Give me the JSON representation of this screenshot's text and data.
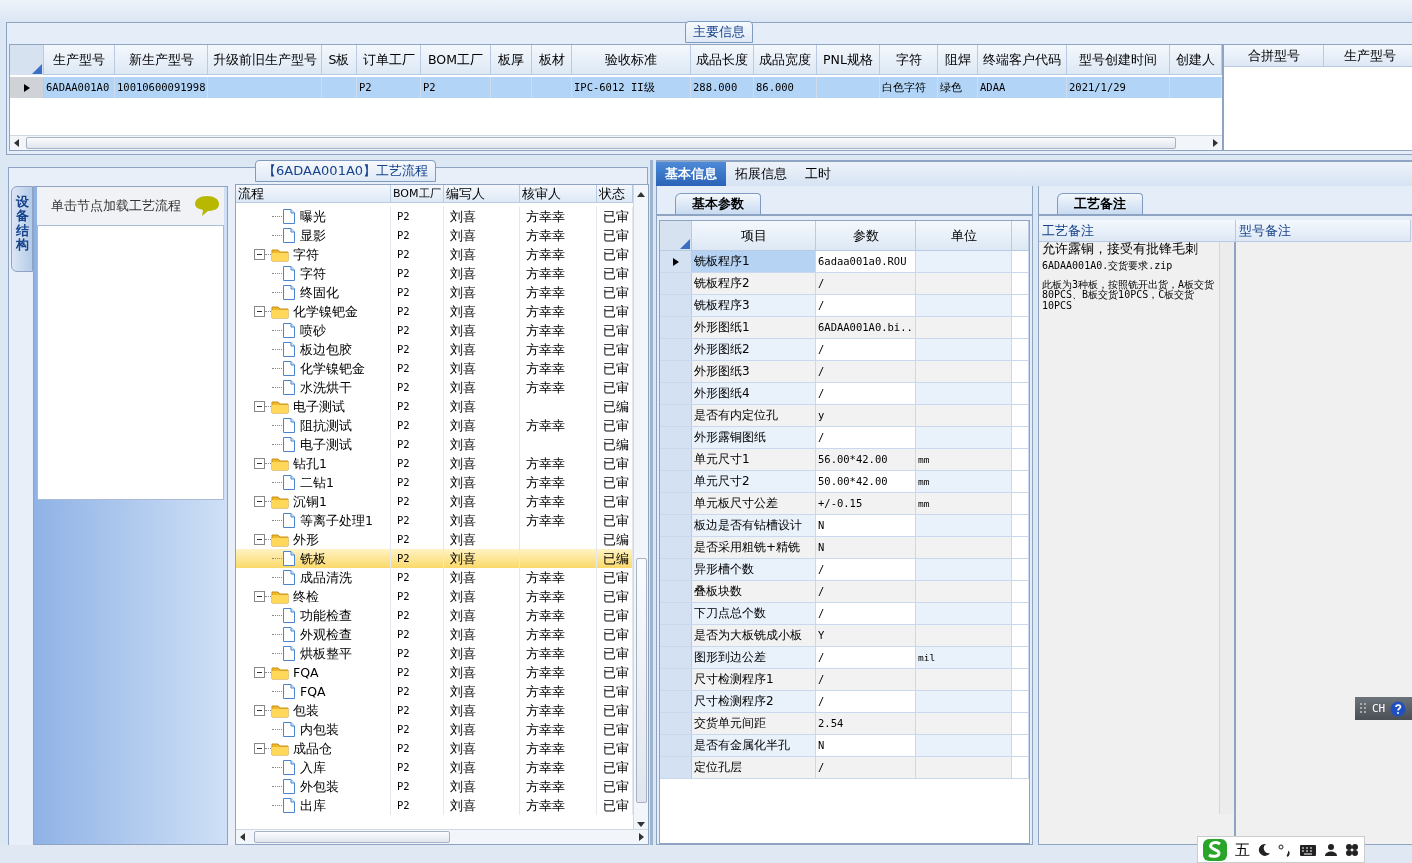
{
  "main_info": {
    "title": "主要信息",
    "columns": [
      "生产型号",
      "新生产型号",
      "升级前旧生产型号",
      "S板",
      "订单工厂",
      "BOM工厂",
      "板厚",
      "板材",
      "验收标准",
      "成品长度",
      "成品宽度",
      "PNL规格",
      "字符",
      "阻焊",
      "终端客户代码",
      "型号创建时间",
      "创建人"
    ],
    "rows": [
      {
        "selected": true,
        "cells": [
          "6ADAA001A0",
          "10010600091998",
          null,
          null,
          "P2",
          "P2",
          null,
          null,
          "IPC-6012 II级",
          "288.000",
          "86.000",
          null,
          "白色字符",
          "绿色",
          "ADAA",
          "2021/1/29",
          null
        ]
      }
    ],
    "side_columns": [
      "合拼型号",
      "生产型号"
    ]
  },
  "process": {
    "title": "【6ADAA001A0】工艺流程",
    "side_tab": "设备结构",
    "hint": "单击节点加载工艺流程",
    "columns": [
      "流程",
      "BOM工厂",
      "编写人",
      "核审人",
      "状态"
    ],
    "nodes": [
      {
        "children": [
          {
            "kind": "step",
            "label": "曝光",
            "factory": "P2",
            "writer": "刘喜",
            "reviewer": "方幸幸",
            "status": "已审",
            "selected": false
          },
          {
            "kind": "step",
            "label": "显影",
            "factory": "P2",
            "writer": "刘喜",
            "reviewer": "方幸幸",
            "status": "已审",
            "selected": false
          }
        ]
      },
      {
        "kind": "group",
        "label": "字符",
        "factory": "P2",
        "writer": "刘喜",
        "reviewer": "方幸幸",
        "status": "已审",
        "selected": false,
        "expanded": true,
        "children": [
          {
            "kind": "step",
            "label": "字符",
            "factory": "P2",
            "writer": "刘喜",
            "reviewer": "方幸幸",
            "status": "已审",
            "selected": false
          },
          {
            "kind": "step",
            "label": "终固化",
            "factory": "P2",
            "writer": "刘喜",
            "reviewer": "方幸幸",
            "status": "已审",
            "selected": false
          }
        ]
      },
      {
        "kind": "group",
        "label": "化学镍钯金",
        "factory": "P2",
        "writer": "刘喜",
        "reviewer": "方幸幸",
        "status": "已审",
        "selected": false,
        "expanded": true,
        "children": [
          {
            "kind": "step",
            "label": "喷砂",
            "factory": "P2",
            "writer": "刘喜",
            "reviewer": "方幸幸",
            "status": "已审",
            "selected": false
          },
          {
            "kind": "step",
            "label": "板边包胶",
            "factory": "P2",
            "writer": "刘喜",
            "reviewer": "方幸幸",
            "status": "已审",
            "selected": false
          },
          {
            "kind": "step",
            "label": "化学镍钯金",
            "factory": "P2",
            "writer": "刘喜",
            "reviewer": "方幸幸",
            "status": "已审",
            "selected": false
          },
          {
            "kind": "step",
            "label": "水洗烘干",
            "factory": "P2",
            "writer": "刘喜",
            "reviewer": "方幸幸",
            "status": "已审",
            "selected": false
          }
        ]
      },
      {
        "kind": "group",
        "label": "电子测试",
        "factory": "P2",
        "writer": "刘喜",
        "status": "已编",
        "selected": false,
        "expanded": true,
        "children": [
          {
            "kind": "step",
            "label": "阻抗测试",
            "factory": "P2",
            "writer": "刘喜",
            "reviewer": "方幸幸",
            "status": "已审",
            "selected": false
          },
          {
            "kind": "step",
            "label": "电子测试",
            "factory": "P2",
            "writer": "刘喜",
            "status": "已编",
            "selected": false
          }
        ]
      },
      {
        "kind": "group",
        "label": "钻孔1",
        "factory": "P2",
        "writer": "刘喜",
        "reviewer": "方幸幸",
        "status": "已审",
        "selected": false,
        "expanded": true,
        "children": [
          {
            "kind": "step",
            "label": "二钻1",
            "factory": "P2",
            "writer": "刘喜",
            "reviewer": "方幸幸",
            "status": "已审",
            "selected": false
          }
        ]
      },
      {
        "kind": "group",
        "label": "沉铜1",
        "factory": "P2",
        "writer": "刘喜",
        "reviewer": "方幸幸",
        "status": "已审",
        "selected": false,
        "expanded": true,
        "children": [
          {
            "kind": "step",
            "label": "等离子处理1",
            "factory": "P2",
            "writer": "刘喜",
            "reviewer": "方幸幸",
            "status": "已审",
            "selected": false
          }
        ]
      },
      {
        "kind": "group",
        "label": "外形",
        "factory": "P2",
        "writer": "刘喜",
        "status": "已编",
        "selected": false,
        "expanded": true,
        "children": [
          {
            "kind": "step",
            "label": "铣板",
            "factory": "P2",
            "writer": "刘喜",
            "status": "已编",
            "selected": true
          },
          {
            "kind": "step",
            "label": "成品清洗",
            "factory": "P2",
            "writer": "刘喜",
            "reviewer": "方幸幸",
            "status": "已审",
            "selected": false
          }
        ]
      },
      {
        "kind": "group",
        "label": "终检",
        "factory": "P2",
        "writer": "刘喜",
        "reviewer": "方幸幸",
        "status": "已审",
        "selected": false,
        "expanded": true,
        "children": [
          {
            "kind": "step",
            "label": "功能检查",
            "factory": "P2",
            "writer": "刘喜",
            "reviewer": "方幸幸",
            "status": "已审",
            "selected": false
          },
          {
            "kind": "step",
            "label": "外观检查",
            "factory": "P2",
            "writer": "刘喜",
            "reviewer": "方幸幸",
            "status": "已审",
            "selected": false
          },
          {
            "kind": "step",
            "label": "烘板整平",
            "factory": "P2",
            "writer": "刘喜",
            "reviewer": "方幸幸",
            "status": "已审",
            "selected": false
          }
        ]
      },
      {
        "kind": "group",
        "label": "FQA",
        "factory": "P2",
        "writer": "刘喜",
        "reviewer": "方幸幸",
        "status": "已审",
        "selected": false,
        "expanded": true,
        "children": [
          {
            "kind": "step",
            "label": "FQA",
            "factory": "P2",
            "writer": "刘喜",
            "reviewer": "方幸幸",
            "status": "已审",
            "selected": false
          }
        ]
      },
      {
        "kind": "group",
        "label": "包装",
        "factory": "P2",
        "writer": "刘喜",
        "reviewer": "方幸幸",
        "status": "已审",
        "selected": false,
        "expanded": true,
        "children": [
          {
            "kind": "step",
            "label": "内包装",
            "factory": "P2",
            "writer": "刘喜",
            "reviewer": "方幸幸",
            "status": "已审",
            "selected": false
          }
        ]
      },
      {
        "kind": "group",
        "label": "成品仓",
        "factory": "P2",
        "writer": "刘喜",
        "reviewer": "方幸幸",
        "status": "已审",
        "selected": false,
        "expanded": true,
        "children": [
          {
            "kind": "step",
            "label": "入库",
            "factory": "P2",
            "writer": "刘喜",
            "reviewer": "方幸幸",
            "status": "已审",
            "selected": false
          },
          {
            "kind": "step",
            "label": "外包装",
            "factory": "P2",
            "writer": "刘喜",
            "reviewer": "方幸幸",
            "status": "已审",
            "selected": false
          },
          {
            "kind": "step",
            "label": "出库",
            "factory": "P2",
            "writer": "刘喜",
            "reviewer": "方幸幸",
            "status": "已审",
            "selected": false
          }
        ]
      }
    ]
  },
  "tabs": [
    {
      "label": "基本信息",
      "selected": true
    },
    {
      "label": "拓展信息",
      "selected": false
    },
    {
      "label": "工时",
      "selected": false
    }
  ],
  "params": {
    "tab": "基本参数",
    "columns": [
      "项目",
      "参数",
      "单位"
    ],
    "rows": [
      {
        "item": "铣板程序1",
        "value": "6adaa001a0.ROU",
        "selected": true
      },
      {
        "item": "铣板程序2",
        "value": "/",
        "selected": false
      },
      {
        "item": "铣板程序3",
        "value": "/",
        "selected": false
      },
      {
        "item": "外形图纸1",
        "value": "6ADAA001A0.bi...",
        "selected": false
      },
      {
        "item": "外形图纸2",
        "value": "/",
        "selected": false
      },
      {
        "item": "外形图纸3",
        "value": "/",
        "selected": false
      },
      {
        "item": "外形图纸4",
        "value": "/",
        "selected": false
      },
      {
        "item": "是否有内定位孔",
        "value": "y",
        "selected": false
      },
      {
        "item": "外形露铜图纸",
        "value": "/",
        "selected": false
      },
      {
        "item": "单元尺寸1",
        "value": "56.00*42.00",
        "unit": "mm",
        "selected": false
      },
      {
        "item": "单元尺寸2",
        "value": "50.00*42.00",
        "unit": "mm",
        "selected": false
      },
      {
        "item": "单元板尺寸公差",
        "value": "+/-0.15",
        "unit": "mm",
        "selected": false
      },
      {
        "item": "板边是否有钻槽设计",
        "value": "N",
        "selected": false
      },
      {
        "item": "是否采用粗铣+精铣",
        "value": "N",
        "selected": false
      },
      {
        "item": "异形槽个数",
        "value": "/",
        "selected": false
      },
      {
        "item": "叠板块数",
        "value": "/",
        "selected": false
      },
      {
        "item": "下刀点总个数",
        "value": "/",
        "selected": false
      },
      {
        "item": "是否为大板铣成小板",
        "value": "Y",
        "selected": false
      },
      {
        "item": "图形到边公差",
        "value": "/",
        "unit": "mil",
        "selected": false
      },
      {
        "item": "尺寸检测程序1",
        "value": "/",
        "selected": false
      },
      {
        "item": "尺寸检测程序2",
        "value": "/",
        "selected": false
      },
      {
        "item": "交货单元间距",
        "value": "2.54",
        "selected": false
      },
      {
        "item": "是否有金属化半孔",
        "value": "N",
        "selected": false
      },
      {
        "item": "定位孔层",
        "value": "/",
        "selected": false
      }
    ]
  },
  "notes": {
    "tab": "工艺备注",
    "columns": [
      "工艺备注",
      "型号备注"
    ],
    "lines": [
      "允许露铜，接受有批锋毛刺",
      "6ADAA001A0.交货要求.zip",
      "此板为3种板，按照铣开出货，A板交货80PCS、B板交货10PCS，C板交货10PCS"
    ]
  },
  "ime": {
    "language": "CH",
    "mode": "五"
  }
}
